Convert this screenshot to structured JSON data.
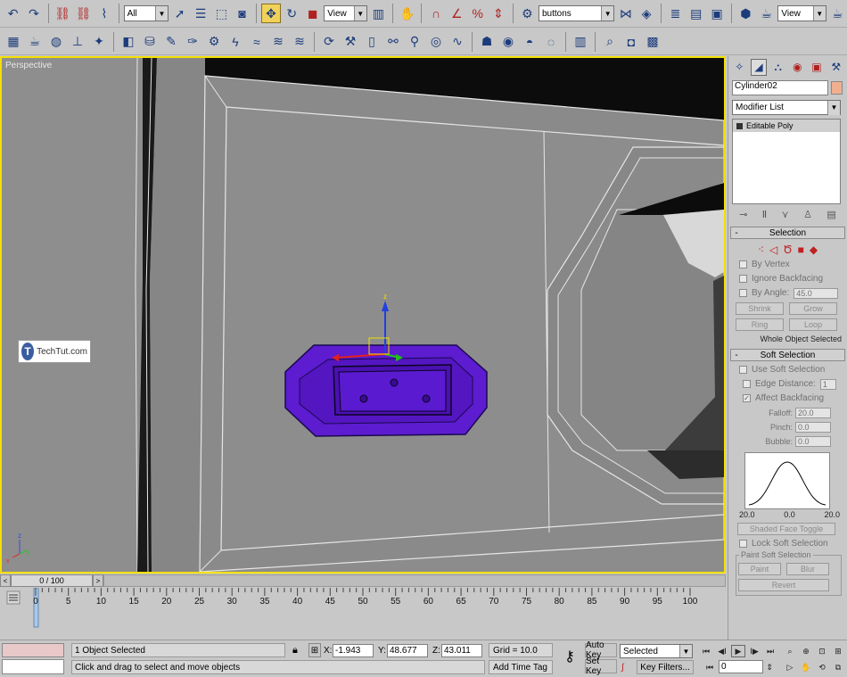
{
  "toolbar1": {
    "selection_filter": "All",
    "reference_coord": "View",
    "named_selection": "buttons",
    "render_view": "View"
  },
  "viewport": {
    "label": "Perspective",
    "gizmo_z": "z",
    "axis_y": "y",
    "axis_x": "x"
  },
  "watermark": {
    "text": "TechTut.com",
    "logo_letter": "T"
  },
  "command_panel": {
    "object_name": "Cylinder02",
    "object_color": "#f0b090",
    "modifier_list": "Modifier List",
    "stack_items": [
      "Editable Poly"
    ],
    "selection": {
      "title": "Selection",
      "by_vertex": "By Vertex",
      "ignore_backfacing": "Ignore Backfacing",
      "by_angle": "By Angle:",
      "by_angle_value": "45.0",
      "shrink": "Shrink",
      "grow": "Grow",
      "ring": "Ring",
      "loop": "Loop",
      "status": "Whole Object Selected"
    },
    "soft_selection": {
      "title": "Soft Selection",
      "use_soft_selection": "Use Soft Selection",
      "edge_distance": "Edge Distance:",
      "edge_distance_value": "1",
      "affect_backfacing": "Affect Backfacing",
      "falloff_label": "Falloff:",
      "falloff": "20.0",
      "pinch_label": "Pinch:",
      "pinch": "0.0",
      "bubble_label": "Bubble:",
      "bubble": "0.0",
      "curve_left": "20.0",
      "curve_mid": "0.0",
      "curve_right": "20.0",
      "shaded_face_toggle": "Shaded Face Toggle",
      "lock_soft_selection": "Lock Soft Selection",
      "paint_soft_selection": "Paint Soft Selection",
      "paint": "Paint",
      "blur": "Blur",
      "revert": "Revert"
    }
  },
  "time_slider": {
    "frame_counter": "0 / 100",
    "ticks": [
      "0",
      "5",
      "10",
      "15",
      "20",
      "25",
      "30",
      "35",
      "40",
      "45",
      "50",
      "55",
      "60",
      "65",
      "70",
      "75",
      "80",
      "85",
      "90",
      "95",
      "100"
    ]
  },
  "status": {
    "selection_info": "1 Object Selected",
    "prompt": "Click and drag to select and move objects",
    "x_label": "X:",
    "x": "-1.943",
    "y_label": "Y:",
    "y": "48.677",
    "z_label": "Z:",
    "z": "43.011",
    "grid": "Grid = 10.0",
    "add_time_tag": "Add Time Tag",
    "auto_key": "Auto Key",
    "set_key": "Set Key",
    "key_mode": "Selected",
    "key_filters": "Key Filters...",
    "current_frame": "0"
  }
}
